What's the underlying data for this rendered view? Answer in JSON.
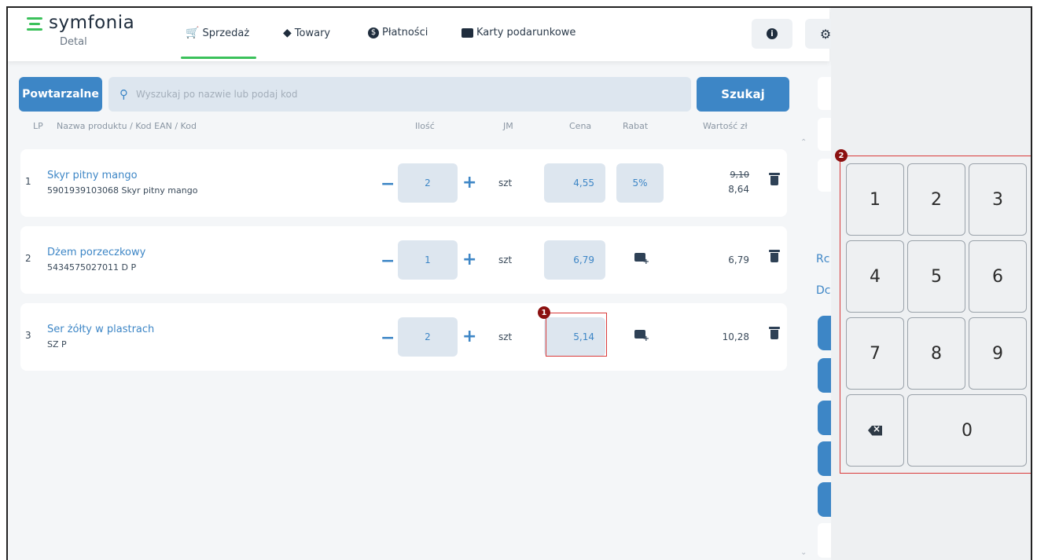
{
  "app": {
    "logo_text": "symfonia",
    "logo_sub": "Detal"
  },
  "nav": [
    {
      "label": "Sprzedaż",
      "icon": "cart-icon"
    },
    {
      "label": "Towary",
      "icon": "tag-icon"
    },
    {
      "label": "Płatności",
      "icon": "dollar-circle-icon"
    },
    {
      "label": "Karty podarunkowe",
      "icon": "gift-card-icon"
    }
  ],
  "search": {
    "recurring_label": "Powtarzalne",
    "placeholder": "Wyszukaj po nazwie lub podaj kod",
    "search_label": "Szukaj"
  },
  "table": {
    "headers": {
      "lp": "LP",
      "name": "Nazwa produktu / Kod EAN / Kod",
      "qty": "Ilość",
      "unit": "JM",
      "price": "Cena",
      "discount": "Rabat",
      "value": "Wartość zł"
    },
    "rows": [
      {
        "lp": "1",
        "name": "Skyr pitny mango",
        "code": "5901939103068 Skyr pitny mango",
        "qty": "2",
        "unit": "szt",
        "price": "4,55",
        "discount": "5%",
        "value_old": "9,10",
        "value": "8,64"
      },
      {
        "lp": "2",
        "name": "Dżem porzeczkowy",
        "code": "5434575027011 D P",
        "qty": "1",
        "unit": "szt",
        "price": "6,79",
        "discount": "",
        "value": "6,79"
      },
      {
        "lp": "3",
        "name": "Ser żółty w plastrach",
        "code": "SZ P",
        "qty": "2",
        "unit": "szt",
        "price": "5,14",
        "discount": "",
        "value": "10,28"
      }
    ]
  },
  "side": {
    "text1": "Rc",
    "text2": "Dc"
  },
  "keypad": {
    "keys": [
      "1",
      "2",
      "3",
      "4",
      "5",
      "6",
      "7",
      "8",
      "9",
      "0"
    ]
  },
  "markers": [
    "1",
    "2"
  ],
  "colors": {
    "accent": "#3d86c6",
    "brand_green": "#3bc15b",
    "highlight_red": "#d93a3a",
    "marker": "#8b1010"
  }
}
